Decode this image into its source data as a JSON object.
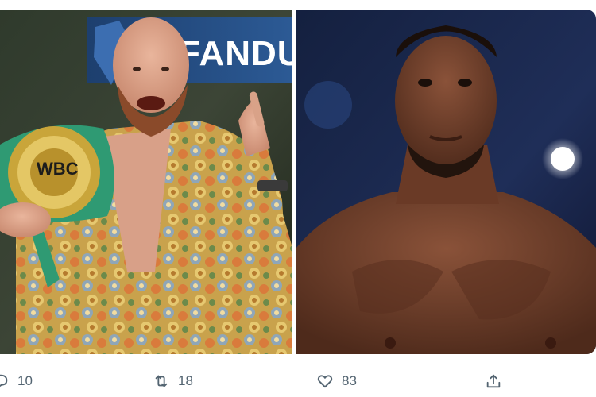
{
  "media": {
    "left_photo": {
      "sponsor_text": "FANDU",
      "belt_text": "WBC"
    },
    "right_photo": {}
  },
  "actions": {
    "reply_count": "10",
    "retweet_count": "18",
    "like_count": "83"
  }
}
